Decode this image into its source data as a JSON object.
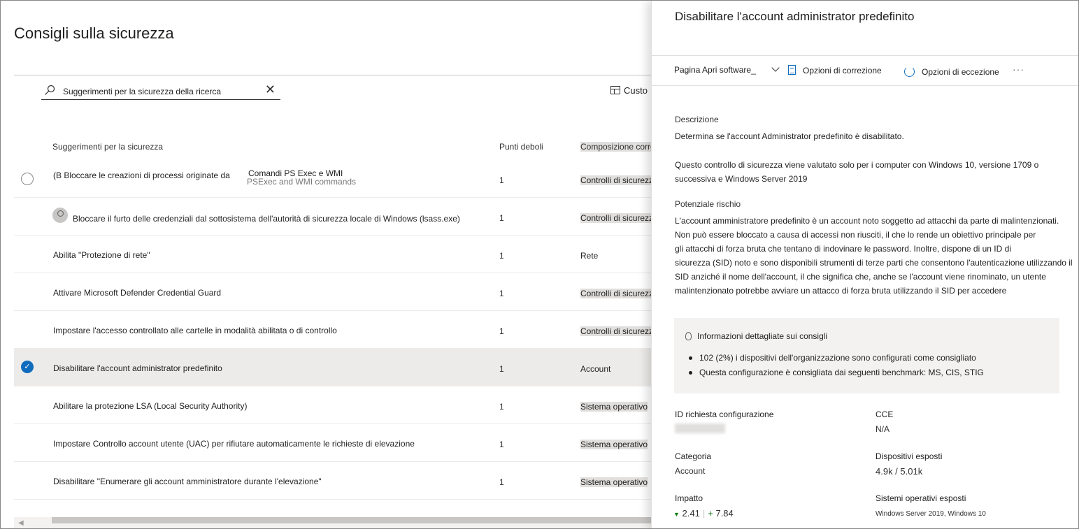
{
  "page": {
    "title": "Consigli sulla sicurezza",
    "customize_label": "Custo"
  },
  "search": {
    "value": "Suggerimenti per la sicurezza della ricerca"
  },
  "table": {
    "headers": {
      "name": "Suggerimenti per la sicurezza",
      "weak": "Punti deboli",
      "composition": "Composizione correlata"
    },
    "rows": [
      {
        "name": "(B Bloccare le creazioni di processi originate da",
        "overlay": "Comandi PS Exec e WMI",
        "ghost": "PSExec and WMI commands",
        "weak": "1",
        "composition": "Controlli di sicurezza",
        "state": "radio"
      },
      {
        "name": "Bloccare il furto delle credenziali dal sottosistema dell'autorità di sicurezza locale di Windows (lsass.exe)",
        "weak": "1",
        "composition": "Controlli di sicurezza",
        "state": "avatar"
      },
      {
        "name": "Abilita \"Protezione di rete\"",
        "weak": "1",
        "composition": "Rete",
        "state": "none"
      },
      {
        "name": "Attivare Microsoft Defender Credential Guard",
        "weak": "1",
        "composition": "Controlli di sicurezza (",
        "state": "none"
      },
      {
        "name": "Impostare l'accesso controllato alle cartelle in modalità abilitata o di controllo",
        "weak": "1",
        "composition": "Controlli di sicurezza (",
        "state": "none"
      },
      {
        "name": "Disabilitare l'account administrator predefinito",
        "weak": "1",
        "composition": "Account",
        "state": "checked"
      },
      {
        "name": "Abilitare la protezione LSA (Local Security Authority)",
        "weak": "1",
        "composition": "Sistema operativo",
        "state": "none"
      },
      {
        "name": "Impostare Controllo account utente (UAC) per rifiutare automaticamente le richieste di elevazione",
        "weak": "1",
        "composition": "Sistema operativo",
        "state": "none"
      },
      {
        "name": "Disabilitare \"Enumerare gli account amministratore durante l'elevazione\"",
        "weak": "1",
        "composition": "Sistema operativo",
        "state": "none"
      }
    ]
  },
  "panel": {
    "title": "Disabilitare l'account administrator predefinito",
    "commands": {
      "software_page": "Pagina Apri software",
      "remediation": "Opzioni di correzione",
      "exception": "Opzioni di eccezione",
      "more": "···"
    },
    "description_label": "Descrizione",
    "description_1": "Determina se l'account Administrator predefinito è disabilitato.",
    "description_2a": "Questo controllo di sicurezza viene valutato solo per i computer con Windows 10, versione 1709 o",
    "description_2b": "successiva e Windows Server 2019",
    "risk_label": "Potenziale rischio",
    "risk_lines": [
      "L'account amministratore predefinito è un account noto soggetto ad attacchi da parte di malintenzionati.",
      "Non può essere bloccato a causa di accessi non riusciti, il che lo rende un obiettivo principale per",
      "gli attacchi di forza bruta che tentano di indovinare le password. Inoltre, dispone di un ID di",
      "sicurezza (SID) noto e sono disponibili strumenti di terze parti che consentono l'autenticazione utilizzando il",
      "SID anziché il nome dell'account, il che significa che, anche se l'account viene rinominato, un utente",
      "malintenzionato potrebbe avviare un attacco di forza bruta utilizzando il SID per accedere"
    ],
    "insights": {
      "heading": "Informazioni dettagliate sui consigli",
      "items": [
        "102 (2%) i dispositivi dell'organizzazione sono configurati come consigliato",
        "Questa configurazione è consigliata dai seguenti benchmark: MS, CIS, STIG"
      ]
    },
    "meta": {
      "config_id_label": "ID richiesta configurazione",
      "cce_label": "CCE",
      "cce_value": "N/A",
      "category_label": "Categoria",
      "category_value": "Account",
      "exposed_devices_label": "Dispositivi esposti",
      "exposed_devices_value": "4.9k / 5.01k",
      "impact_label": "Impatto",
      "impact_down": "2.41",
      "impact_up": "7.84",
      "exposed_os_label": "Sistemi operativi esposti",
      "exposed_os_value": "Windows Server 2019, Windows 10"
    }
  },
  "colors": {
    "accent": "#0f6cbd",
    "selected_row": "#edebe9",
    "impact_green": "#107c10"
  }
}
